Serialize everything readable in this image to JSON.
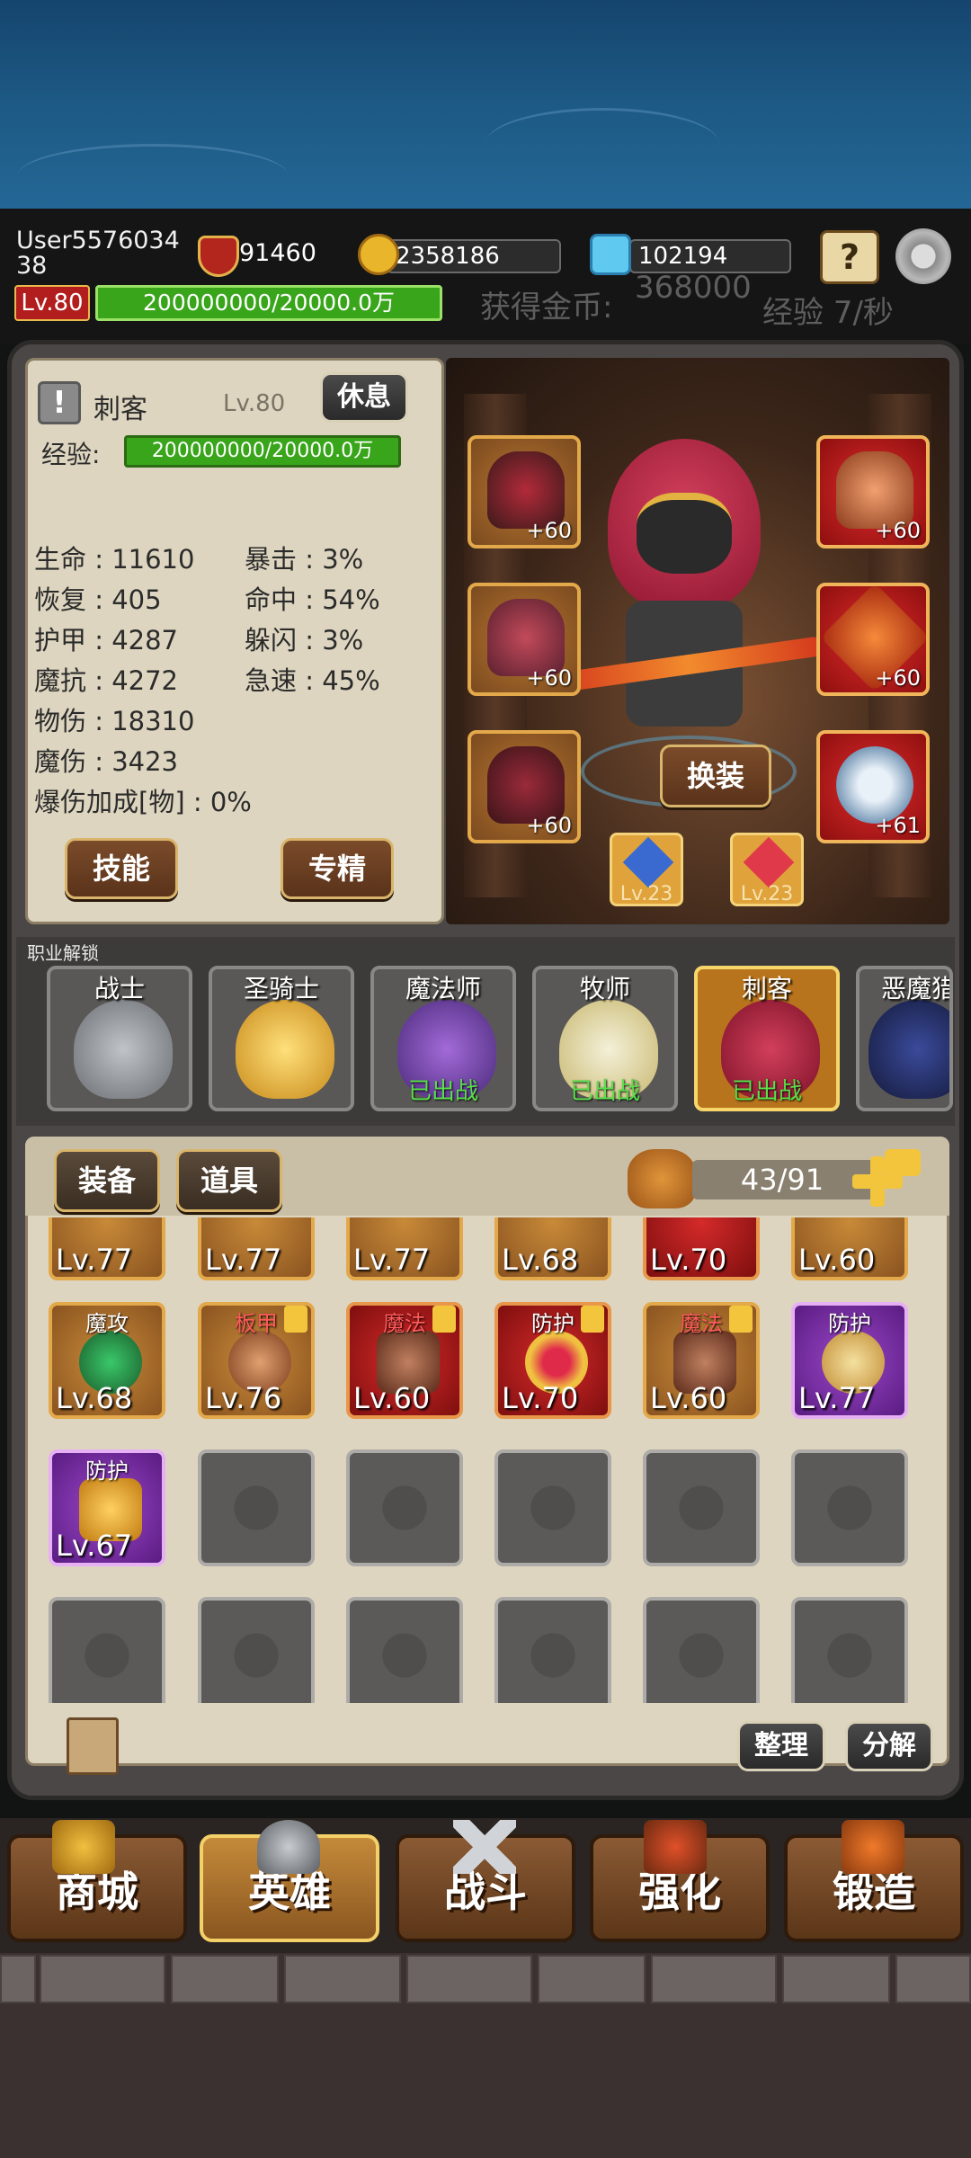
{
  "top": {
    "username": "User557603438",
    "power": "91460",
    "gold": "2358186",
    "diamonds": "102194",
    "level": "Lv.80",
    "exp_bar": "200000000/20000.0万",
    "gold_rate_label": "获得金币:",
    "gold_rate_value": "368000",
    "exp_rate": "经验 7/秒"
  },
  "hero": {
    "class_name": "刺客",
    "level": "Lv.80",
    "rest_button": "休息",
    "exp_label": "经验:",
    "exp_bar": "200000000/20000.0万",
    "stats_left": [
      "生命 : 11610",
      "恢复 : 405",
      "护甲 : 4287",
      "魔抗 : 4272",
      "物伤 : 18310",
      "魔伤 : 3423",
      "爆伤加成[物] : 0%"
    ],
    "stats_right": [
      "暴击 : 3%",
      "命中 : 54%",
      "躲闪 : 3%",
      "急速 : 45%"
    ],
    "skill_button": "技能",
    "mastery_button": "专精",
    "swap_button": "换装",
    "equip_left_plus": [
      "+60",
      "+60",
      "+60"
    ],
    "equip_right_plus": [
      "+60",
      "+60",
      "+61"
    ],
    "gem_levels": [
      "Lv.23",
      "Lv.23"
    ]
  },
  "classes": {
    "section_label": "职业解锁",
    "items": [
      {
        "name": "战士",
        "status": ""
      },
      {
        "name": "圣骑士",
        "status": ""
      },
      {
        "name": "魔法师",
        "status": "已出战"
      },
      {
        "name": "牧师",
        "status": "已出战"
      },
      {
        "name": "刺客",
        "status": "已出战"
      },
      {
        "name": "恶魔猎",
        "status": ""
      }
    ]
  },
  "inventory": {
    "tab_equipment": "装备",
    "tab_items": "道具",
    "bag_count": "43/91",
    "sort_button": "整理",
    "decompose_button": "分解",
    "row1_levels": [
      "Lv.77",
      "Lv.77",
      "Lv.77",
      "Lv.68",
      "Lv.70",
      "Lv.60"
    ],
    "row2": [
      {
        "tag": "魔攻",
        "level": "Lv.68"
      },
      {
        "tag": "板甲",
        "level": "Lv.76"
      },
      {
        "tag": "魔法",
        "level": "Lv.60"
      },
      {
        "tag": "防护",
        "level": "Lv.70"
      },
      {
        "tag": "魔法",
        "level": "Lv.60"
      },
      {
        "tag": "防护",
        "level": "Lv.77"
      }
    ],
    "row3": [
      {
        "tag": "防护",
        "level": "Lv.67"
      }
    ]
  },
  "nav": {
    "shop": "商城",
    "hero": "英雄",
    "battle": "战斗",
    "enhance": "强化",
    "forge": "锻造"
  },
  "colors": {
    "exp_green": "#38a51a",
    "level_red": "#b21e1e",
    "deployed_green": "#58e04a"
  }
}
